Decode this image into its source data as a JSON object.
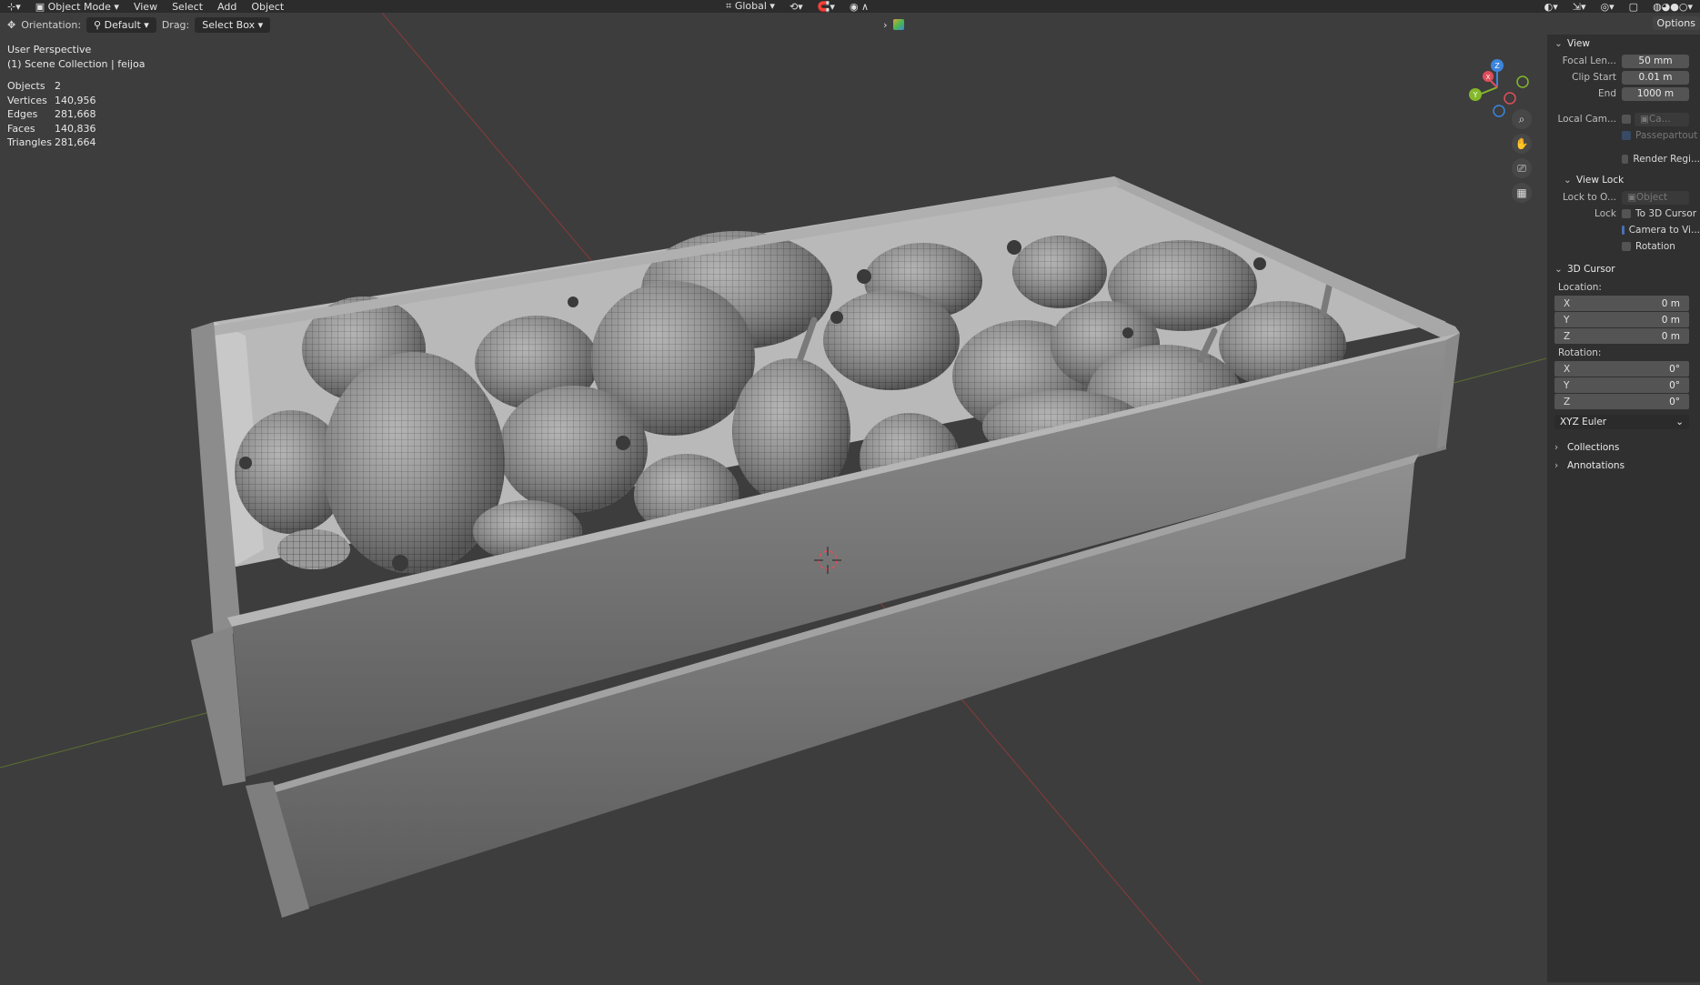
{
  "header": {
    "mode": "Object Mode",
    "menus": [
      "View",
      "Select",
      "Add",
      "Object"
    ],
    "transform_orientation": "Global",
    "options_label": "Options"
  },
  "toolbar": {
    "orientation_label": "Orientation:",
    "orientation_value": "Default",
    "drag_label": "Drag:",
    "drag_value": "Select Box"
  },
  "viewport": {
    "perspective": "User Perspective",
    "collection": "(1) Scene Collection | feijoa",
    "stats": [
      {
        "k": "Objects",
        "v": "2"
      },
      {
        "k": "Vertices",
        "v": "140,956"
      },
      {
        "k": "Edges",
        "v": "281,668"
      },
      {
        "k": "Faces",
        "v": "140,836"
      },
      {
        "k": "Triangles",
        "v": "281,664"
      }
    ],
    "gizmo_axes": {
      "x": "X",
      "y": "Y",
      "z": "Z"
    },
    "colors": {
      "x": "#e04e5b",
      "y": "#84b82a",
      "z": "#3c85dd",
      "grid_x": "#8a3a3a",
      "grid_y": "#5b7030"
    }
  },
  "sidebar": {
    "view": {
      "title": "View",
      "focal_label": "Focal Len...",
      "focal_value": "50 mm",
      "clip_start_label": "Clip Start",
      "clip_start_value": "0.01 m",
      "clip_end_label": "End",
      "clip_end_value": "1000 m",
      "local_cam_label": "Local Cam...",
      "local_cam_value": "Ca...",
      "passepartout_label": "Passepartout",
      "render_region_label": "Render Regi..."
    },
    "view_lock": {
      "title": "View Lock",
      "lock_to_label": "Lock to O...",
      "lock_to_value": "Object",
      "lock_label": "Lock",
      "to_cursor_label": "To 3D Cursor",
      "camera_to_view_label": "Camera to Vi...",
      "rotation_label": "Rotation"
    },
    "cursor": {
      "title": "3D Cursor",
      "location_label": "Location:",
      "location": [
        {
          "axis": "X",
          "value": "0 m"
        },
        {
          "axis": "Y",
          "value": "0 m"
        },
        {
          "axis": "Z",
          "value": "0 m"
        }
      ],
      "rotation_label": "Rotation:",
      "rotation": [
        {
          "axis": "X",
          "value": "0°"
        },
        {
          "axis": "Y",
          "value": "0°"
        },
        {
          "axis": "Z",
          "value": "0°"
        }
      ],
      "rotation_mode": "XYZ Euler"
    },
    "collections_title": "Collections",
    "annotations_title": "Annotations"
  }
}
